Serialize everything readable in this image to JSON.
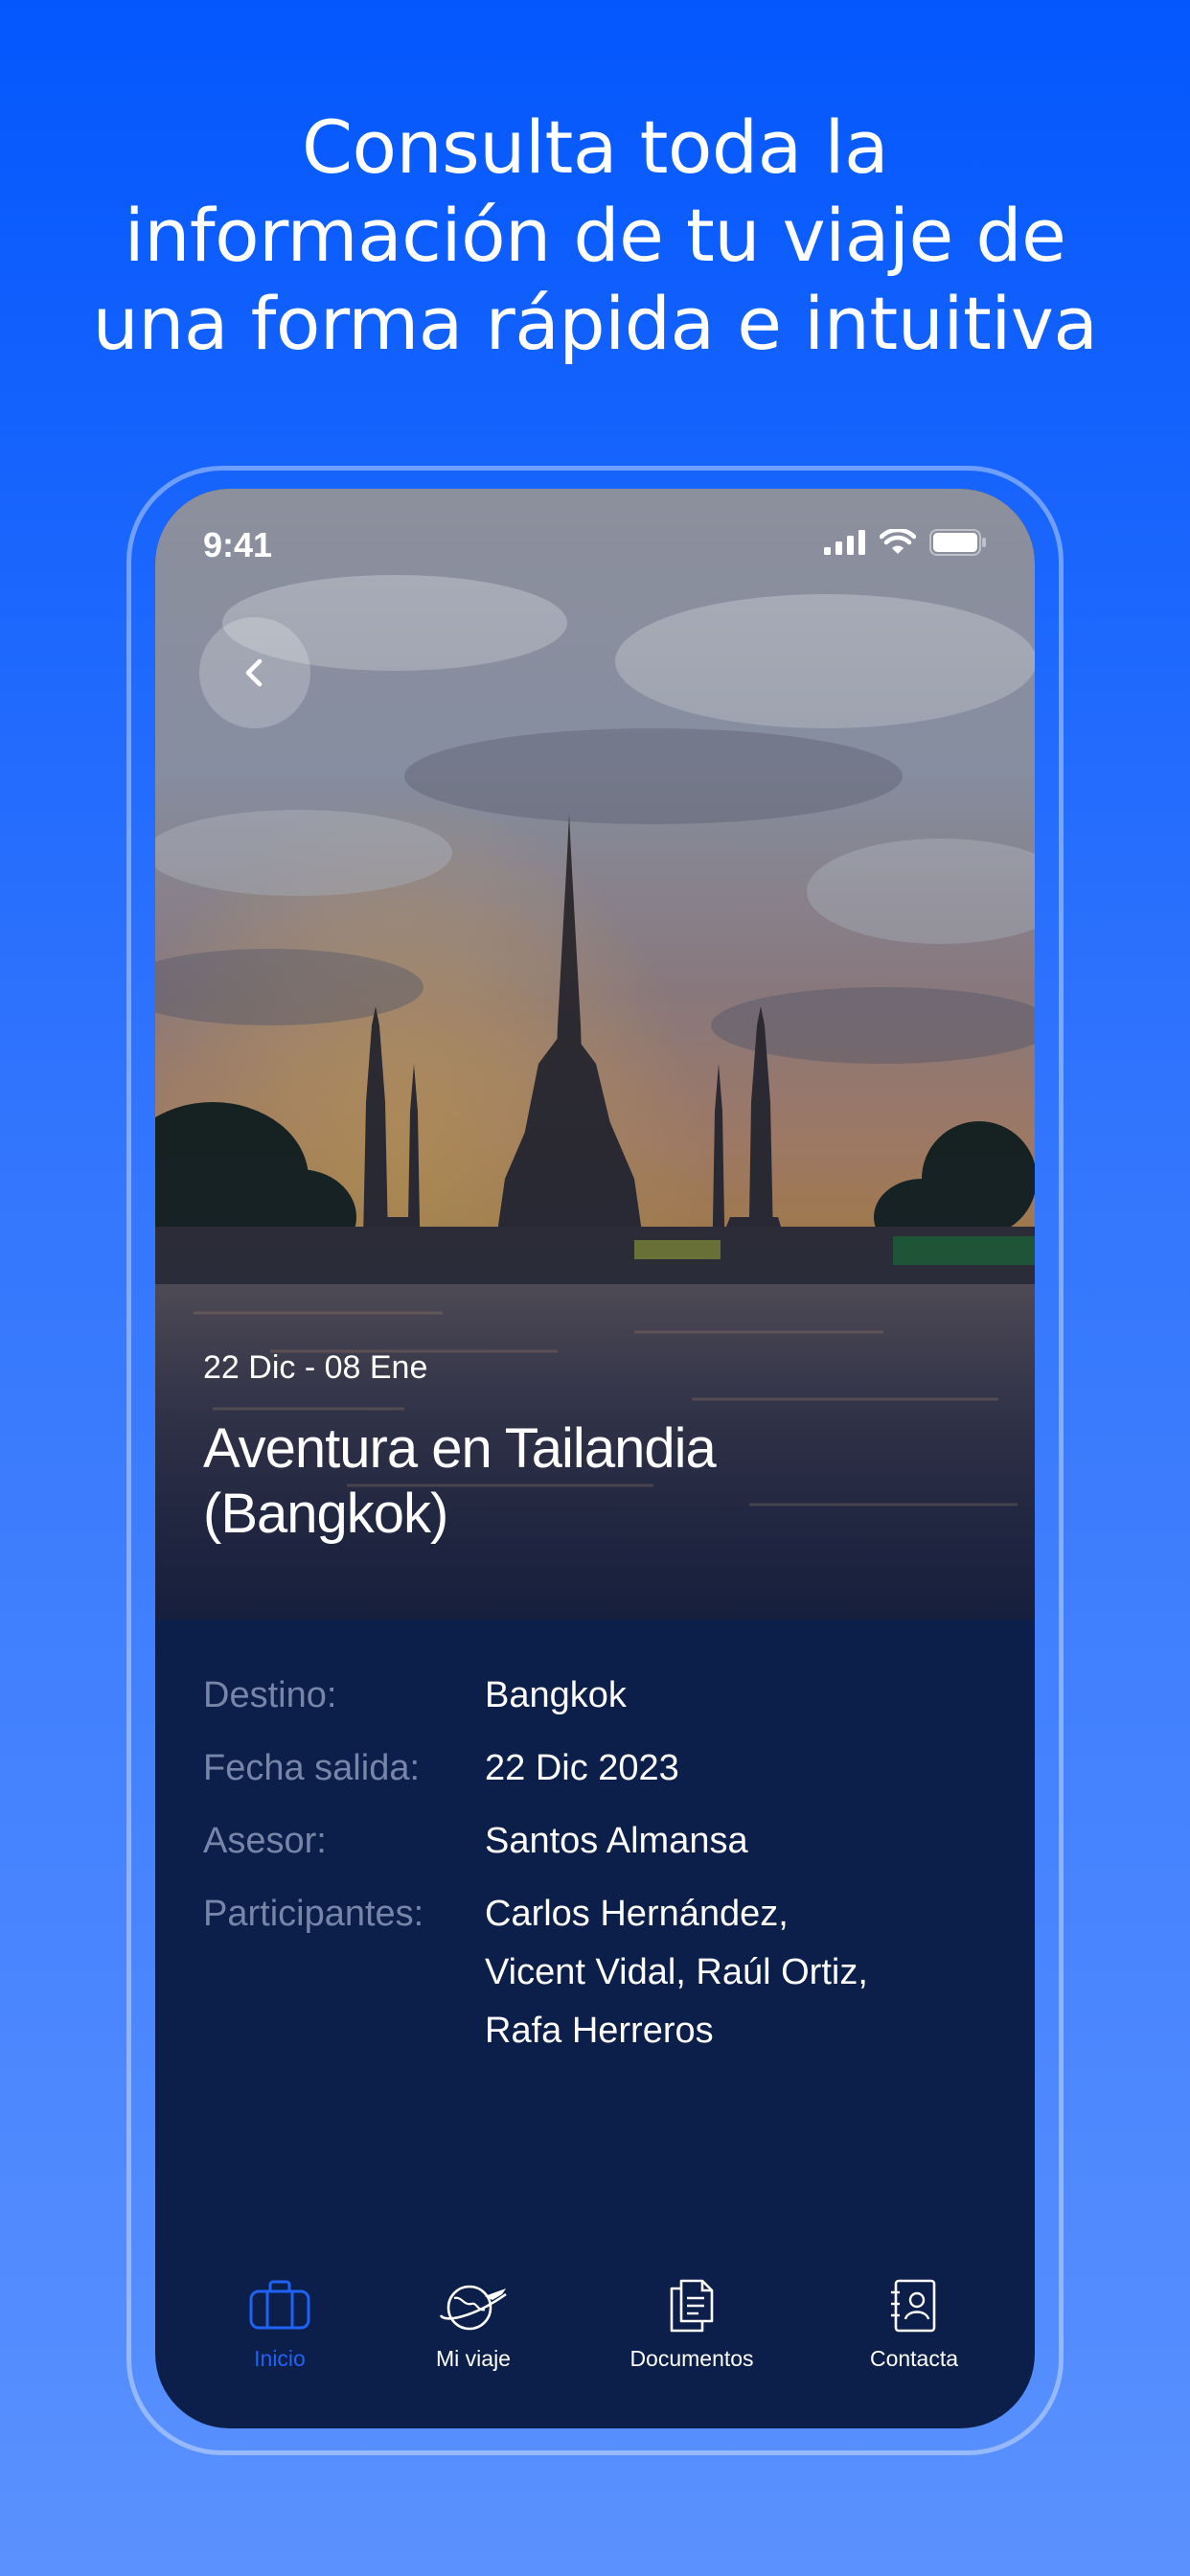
{
  "headline": {
    "line1": "Consulta toda la",
    "line2": "información de tu viaje de",
    "line3": "una forma rápida e intuitiva"
  },
  "status_bar": {
    "time": "9:41"
  },
  "trip": {
    "dates": "22 Dic - 08 Ene",
    "title": "Aventura en Tailandia (Bangkok)"
  },
  "details": [
    {
      "label": "Destino:",
      "value": "Bangkok"
    },
    {
      "label": "Fecha salida:",
      "value": "22 Dic 2023"
    },
    {
      "label": "Asesor:",
      "value": "Santos Almansa"
    },
    {
      "label": "Participantes:",
      "value_lines": [
        "Carlos Hernández,",
        "Vicent Vidal, Raúl Ortiz,",
        "Rafa Herreros"
      ]
    }
  ],
  "tabs": [
    {
      "label": "Inicio",
      "icon": "suitcase-icon",
      "active": true
    },
    {
      "label": "Mi viaje",
      "icon": "globe-plane-icon",
      "active": false
    },
    {
      "label": "Documentos",
      "icon": "documents-icon",
      "active": false
    },
    {
      "label": "Contacta",
      "icon": "contact-card-icon",
      "active": false
    }
  ],
  "colors": {
    "background_top": "#0357fd",
    "panel": "#0c1f4a",
    "accent": "#1e63f5",
    "label": "#7786a8"
  }
}
